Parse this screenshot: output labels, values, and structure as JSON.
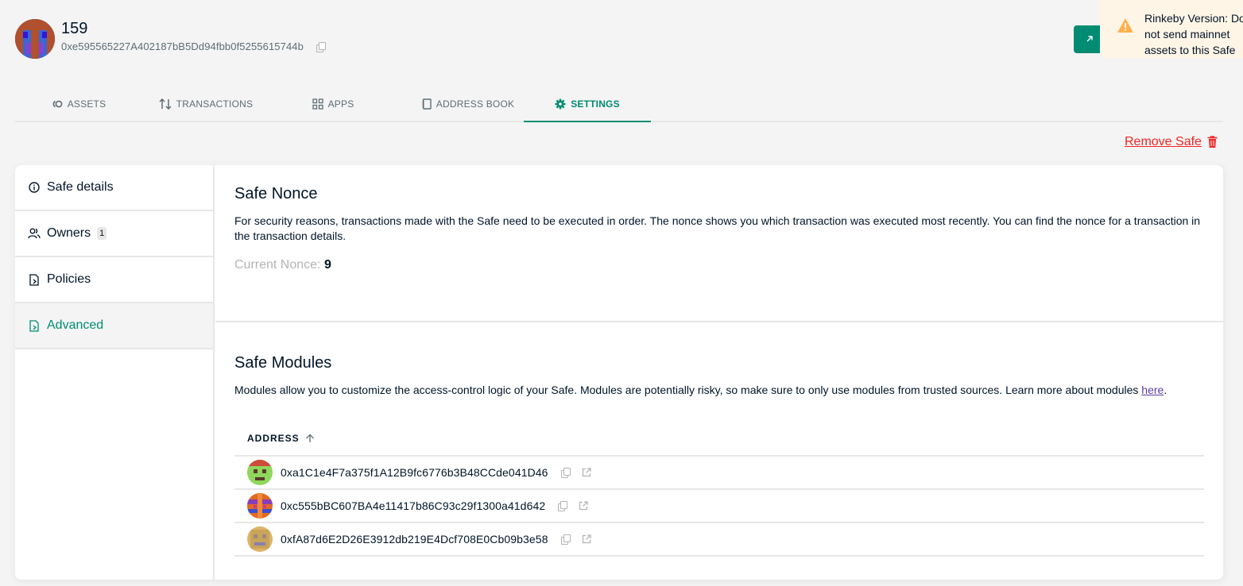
{
  "safe": {
    "name": "159",
    "address": "0xe595565227A402187bB5Dd94fbb0f5255615744b"
  },
  "toast": {
    "text": "Rinkeby Version: Do not send mainnet assets to this Safe"
  },
  "tabs": [
    {
      "label": "ASSETS",
      "icon": "assets-icon"
    },
    {
      "label": "TRANSACTIONS",
      "icon": "transactions-icon"
    },
    {
      "label": "APPS",
      "icon": "apps-icon"
    },
    {
      "label": "ADDRESS BOOK",
      "icon": "address-book-icon"
    },
    {
      "label": "SETTINGS",
      "icon": "settings-icon",
      "active": true
    }
  ],
  "remove_safe": {
    "label": "Remove Safe",
    "icon": "trash-icon",
    "color": "#f02525"
  },
  "menu": [
    {
      "label": "Safe details",
      "icon": "info-icon"
    },
    {
      "label": "Owners",
      "icon": "owners-icon",
      "badge": "1"
    },
    {
      "label": "Policies",
      "icon": "policies-icon"
    },
    {
      "label": "Advanced",
      "icon": "advanced-icon",
      "active": true
    }
  ],
  "nonce": {
    "title": "Safe Nonce",
    "description": "For security reasons, transactions made with the Safe need to be executed in order. The nonce shows you which transaction was executed most recently. You can find the nonce for a transaction in the transaction details.",
    "label": "Current Nonce:",
    "value": "9"
  },
  "modules": {
    "title": "Safe Modules",
    "description": "Modules allow you to customize the access-control logic of your Safe. Modules are potentially risky, so make sure to only use modules from trusted sources. Learn more about modules ",
    "link_text": "here",
    "period": ".",
    "column_header": "ADDRESS",
    "rows": [
      {
        "address": "0xa1C1e4F7a375f1A12B9fc6776b3B48CCde041D46"
      },
      {
        "address": "0xc555bBC607BA4e11417b86C93c29f1300a41d642"
      },
      {
        "address": "0xfA87d6E2D26E3912db219E4Dcf708E0Cb09b3e58"
      }
    ]
  },
  "colors": {
    "accent": "#008c73",
    "warning_bg": "#fff5e6",
    "danger": "#f02525"
  }
}
